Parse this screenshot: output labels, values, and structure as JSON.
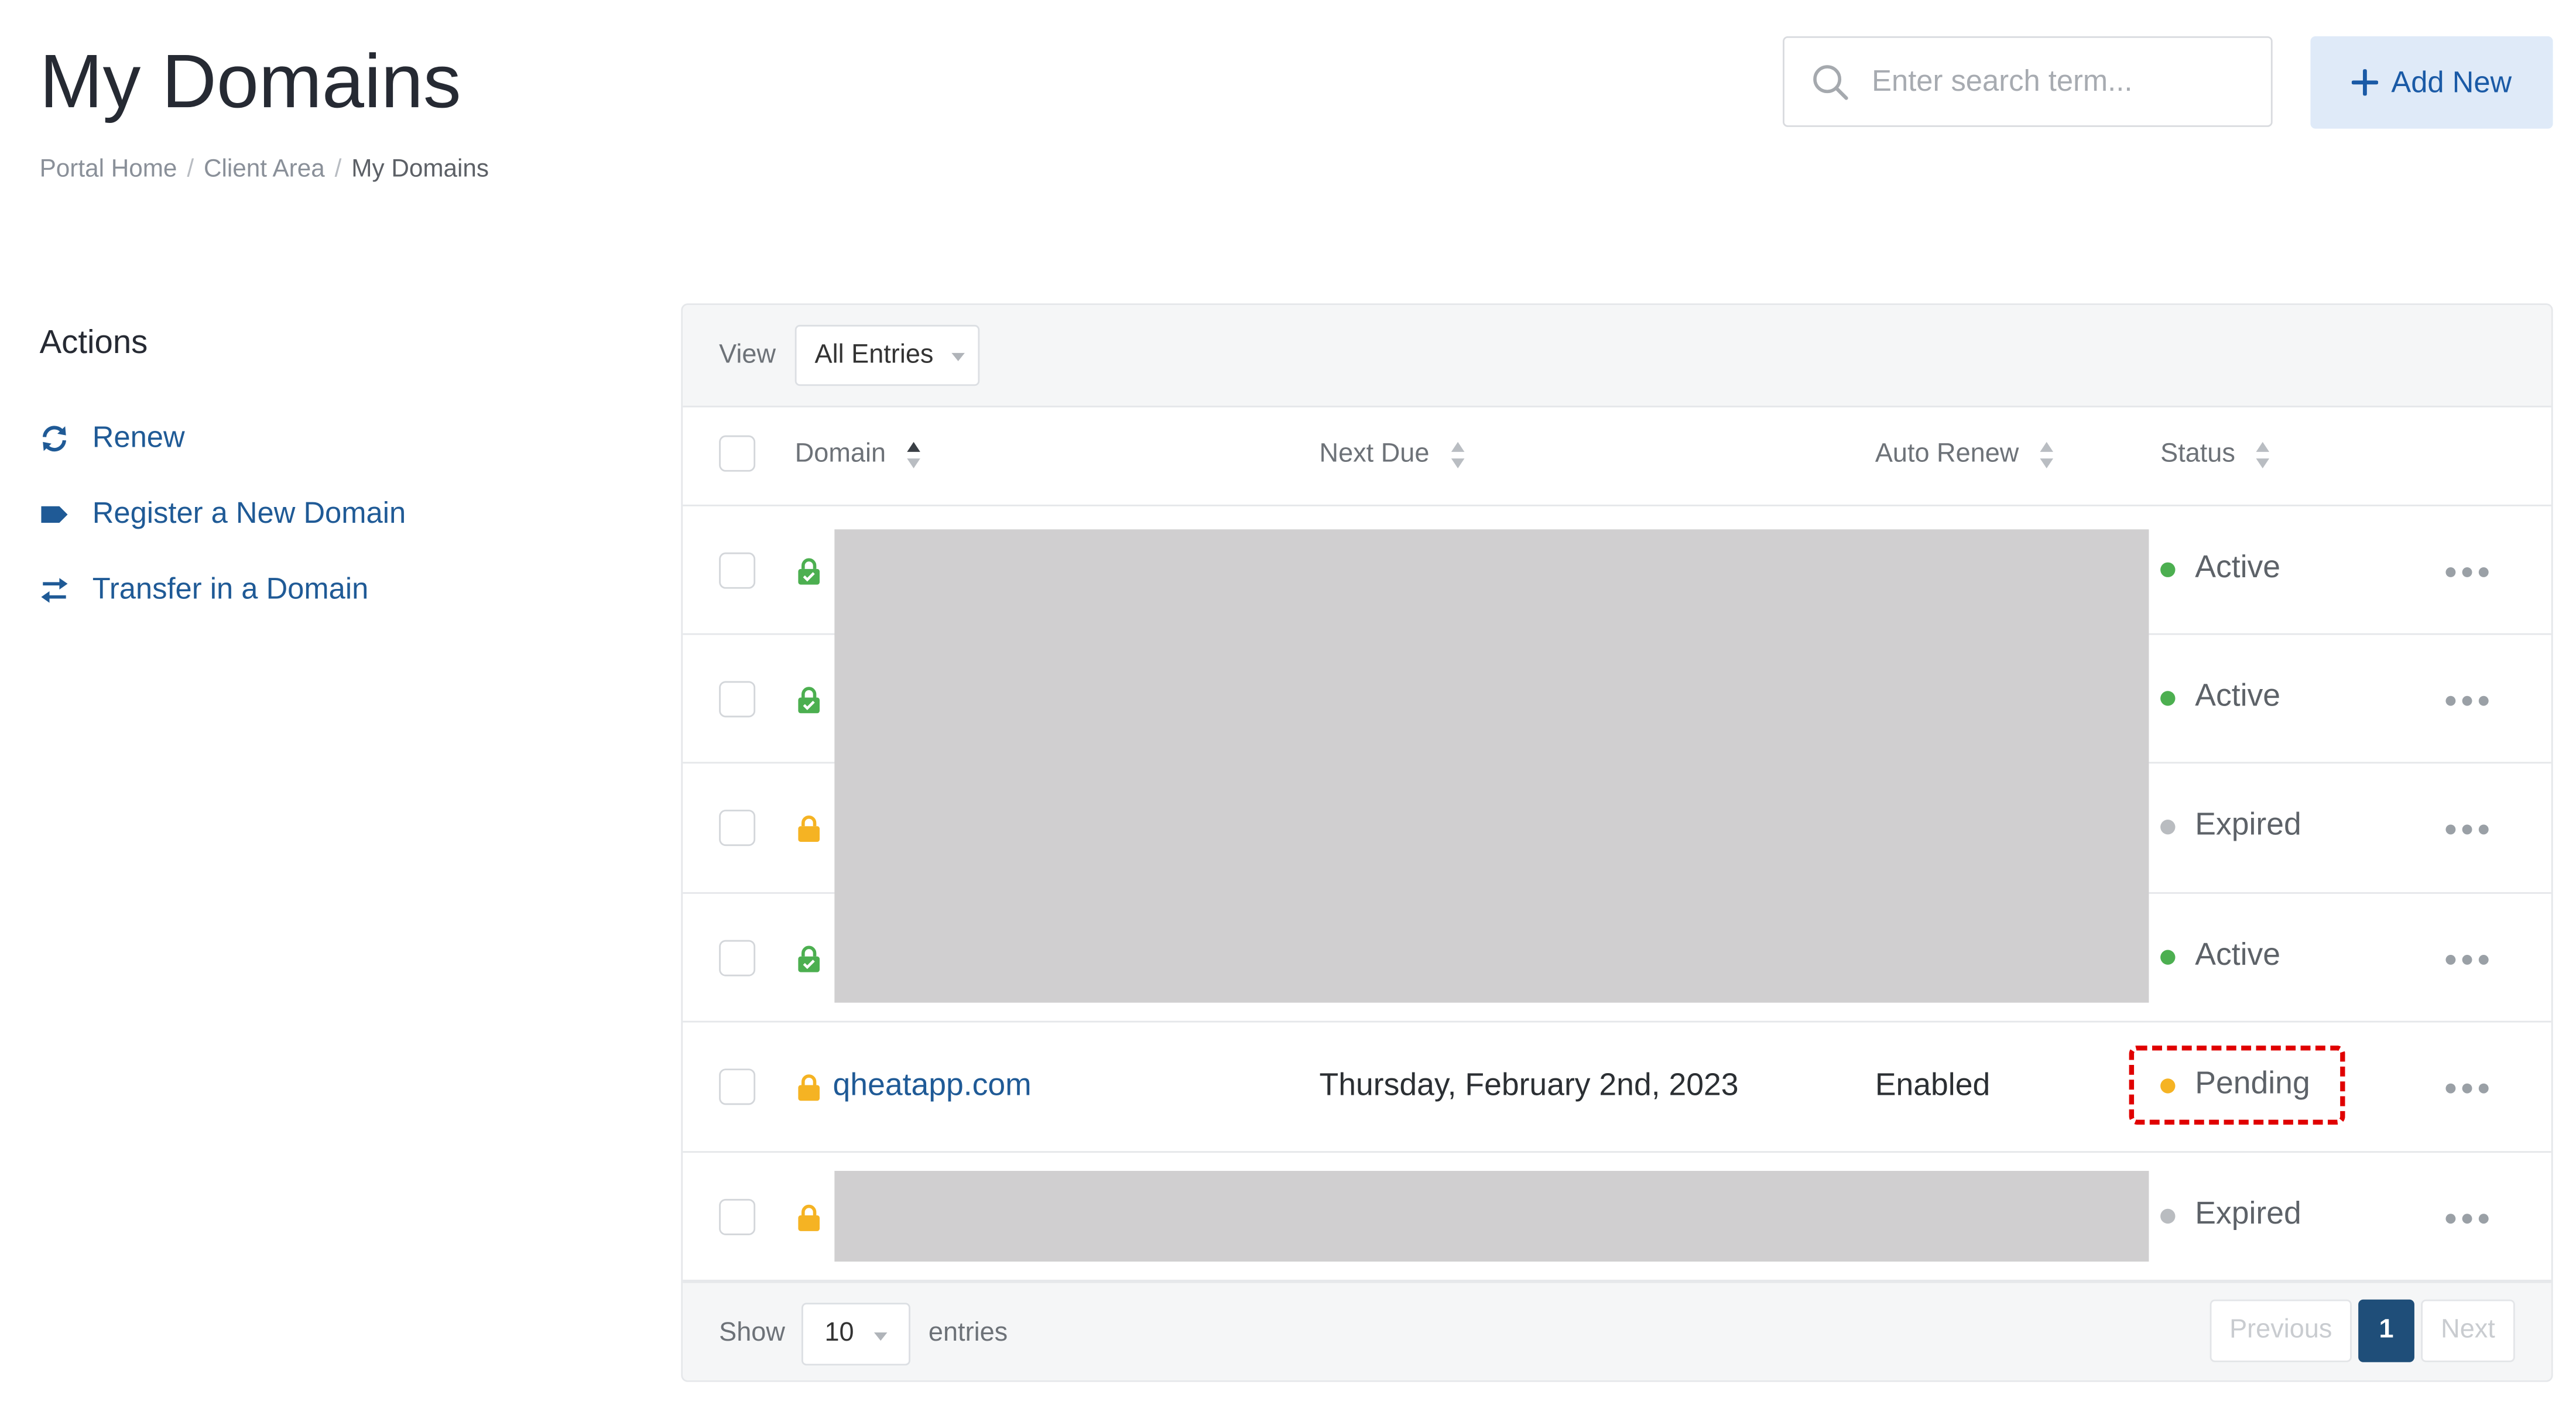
{
  "page": {
    "title": "My Domains"
  },
  "breadcrumb": {
    "items": [
      "Portal Home",
      "Client Area",
      "My Domains"
    ],
    "separator": "/"
  },
  "search": {
    "placeholder": "Enter search term..."
  },
  "add_button": {
    "label": "Add New"
  },
  "sidebar": {
    "heading": "Actions",
    "items": [
      {
        "label": "Renew",
        "icon": "sync-icon"
      },
      {
        "label": "Register a New Domain",
        "icon": "tag-icon"
      },
      {
        "label": "Transfer in a Domain",
        "icon": "transfer-icon"
      }
    ]
  },
  "toolbar": {
    "view_label": "View",
    "view_value": "All Entries"
  },
  "table": {
    "columns": [
      "Domain",
      "Next Due",
      "Auto Renew",
      "Status"
    ],
    "rows": [
      {
        "domain": "",
        "next_due": "",
        "auto_renew": "",
        "status": "Active",
        "lock": "green",
        "redacted": true
      },
      {
        "domain": "",
        "next_due": "",
        "auto_renew": "",
        "status": "Active",
        "lock": "green",
        "redacted": true
      },
      {
        "domain": "",
        "next_due": "",
        "auto_renew": "",
        "status": "Expired",
        "lock": "amber",
        "redacted": true
      },
      {
        "domain": "",
        "next_due": "",
        "auto_renew": "",
        "status": "Active",
        "lock": "green",
        "redacted": true
      },
      {
        "domain": "qheatapp.com",
        "next_due": "Thursday, February 2nd, 2023",
        "auto_renew": "Enabled",
        "status": "Pending",
        "lock": "amber",
        "redacted": false
      },
      {
        "domain": "",
        "next_due": "",
        "auto_renew": "",
        "status": "Expired",
        "lock": "amber",
        "redacted": true
      }
    ]
  },
  "footer": {
    "show_label": "Show",
    "entries_value": "10",
    "entries_label": "entries",
    "pagination": {
      "previous": "Previous",
      "current_page": "1",
      "next": "Next"
    }
  },
  "colors": {
    "active": "#4caf50",
    "pending": "#f5b323",
    "expired": "#b9bcc0",
    "lock_green": "#4caf50",
    "lock_amber": "#f5b323",
    "link": "#1f5a96",
    "pagination_active": "#1f4e79"
  }
}
